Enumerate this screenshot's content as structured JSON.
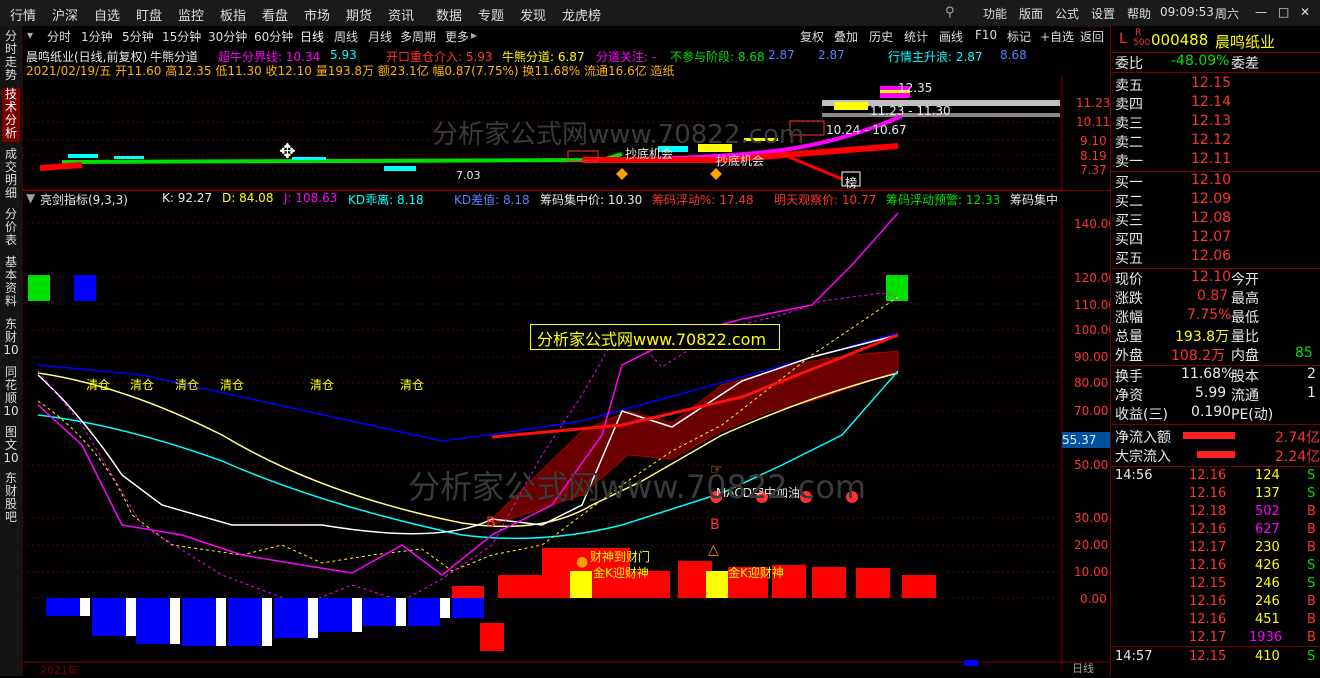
{
  "menu": {
    "items": [
      "行情",
      "沪深",
      "自选",
      "盯盘",
      "监控",
      "板指",
      "看盘",
      "市场",
      "期货",
      "资讯",
      "数据",
      "专题",
      "发现",
      "龙虎榜"
    ],
    "right": [
      "功能",
      "版面",
      "公式",
      "设置",
      "帮助"
    ],
    "time": "09:09:53",
    "weekday": "周六"
  },
  "left_tabs": [
    "分时走势",
    "技术分析",
    "成交明细",
    "分价表",
    "基本资料",
    "东财10",
    "同花顺10",
    "图文10",
    "东财股吧"
  ],
  "periods": [
    "分时",
    "1分钟",
    "5分钟",
    "15分钟",
    "30分钟",
    "60分钟",
    "日线",
    "周线",
    "月线",
    "多周期",
    "更多"
  ],
  "tools": [
    "复权",
    "叠加",
    "历史",
    "统计",
    "画线",
    "F10",
    "标记",
    "+自选",
    "返回"
  ],
  "main_header": {
    "name": "晨鸣纸业(日线,前复权)",
    "ind": "牛熊分道",
    "l1": "超牛分界线: 10.34",
    "l2": "5.93",
    "l3": "开口重仓介入: 5.93",
    "l4": "牛熊分道: 6.87",
    "l5": "分道关注: -",
    "l6": "不参与阶段: 8.68",
    "l7": "2.87",
    "l8": "2.87",
    "l9": "行情主升浪: 2.87",
    "l10": "8.68"
  },
  "ohlc": "2021/02/19/五 开11.60 高12.35 低11.30 收12.10 量193.8万 额23.1亿 幅0.87(7.75%) 换11.68% 流通16.6亿 造纸",
  "upper_axis": [
    "11.23",
    "10.11",
    "9.10",
    "8.19",
    "7.37"
  ],
  "upper_annot": {
    "hi": "12.35",
    "r1": "11.23 - 11.30",
    "r2": "10.24 - 10.67",
    "lo": "7.03",
    "buy1": "抄底机会",
    "buy2": "抄底机会",
    "tag": "榜"
  },
  "watermark1": "分析家公式网www.70822.com",
  "watermark2": "分析家公式网www.70822.com",
  "watermark3": "分析家公式网www.70822.com",
  "lower_header": {
    "name": "亮剑指标(9,3,3)",
    "k": "K: 92.27",
    "d": "D: 84.08",
    "j": "J: 108.63",
    "kdj": "KD乖离: 8.18",
    "kdm": "KD差值: 8.18",
    "c1": "筹码集中价: 10.30",
    "c2": "筹码浮动%: 17.48",
    "c3": "明天观察价: 10.77",
    "c4": "筹码浮动预警: 12.33",
    "c5": "筹码集中"
  },
  "lower_axis": [
    "140.00",
    "120.00",
    "110.00",
    "100.00",
    "90.00",
    "80.00",
    "70.00",
    "50.00",
    "30.00",
    "20.00",
    "10.00",
    "0.00"
  ],
  "cur_val": "55.37",
  "qingcang": [
    "清仓",
    "清仓",
    "清仓",
    "清仓",
    "清仓",
    "清仓"
  ],
  "lower_annot": {
    "b1": "B",
    "b2": "B",
    "a1": "财神到财门",
    "a2": "金K迎财神",
    "a3": "金K迎财神",
    "a4": "MACD空中加油"
  },
  "bottom": {
    "year": "2021年",
    "rt": "日线"
  },
  "stock": {
    "prefix": "L",
    "r": "R",
    "code_sub": "500",
    "code": "000488",
    "name": "晨鸣纸业",
    "weibi_label": "委比",
    "weibi": "-48.09%",
    "weicha_label": "委差",
    "asks": [
      {
        "l": "卖五",
        "p": "12.15"
      },
      {
        "l": "卖四",
        "p": "12.14"
      },
      {
        "l": "卖三",
        "p": "12.13"
      },
      {
        "l": "卖二",
        "p": "12.12"
      },
      {
        "l": "卖一",
        "p": "12.11"
      }
    ],
    "bids": [
      {
        "l": "买一",
        "p": "12.10"
      },
      {
        "l": "买二",
        "p": "12.09"
      },
      {
        "l": "买三",
        "p": "12.08"
      },
      {
        "l": "买四",
        "p": "12.07"
      },
      {
        "l": "买五",
        "p": "12.06"
      }
    ],
    "quote": [
      {
        "l": "现价",
        "v": "12.10",
        "l2": "今开"
      },
      {
        "l": "涨跌",
        "v": "0.87",
        "l2": "最高"
      },
      {
        "l": "涨幅",
        "v": "7.75%",
        "l2": "最低"
      },
      {
        "l": "总量",
        "v": "193.8万",
        "l2": "量比"
      },
      {
        "l": "外盘",
        "v": "108.2万",
        "l2": "内盘",
        "v2": "85"
      }
    ],
    "fin": [
      {
        "l": "换手",
        "v": "11.68%",
        "l2": "股本",
        "v2": "2"
      },
      {
        "l": "净资",
        "v": "5.99",
        "l2": "流通",
        "v2": "1"
      },
      {
        "l": "收益(三)",
        "v": "0.190",
        "l2": "PE(动)",
        "v2": ""
      }
    ],
    "flow": [
      {
        "l": "净流入额",
        "v": "2.74亿"
      },
      {
        "l": "大宗流入",
        "v": "2.24亿"
      }
    ],
    "ticks": [
      {
        "t": "14:56",
        "p": "12.16",
        "v": "124",
        "s": "S"
      },
      {
        "t": "",
        "p": "12.16",
        "v": "137",
        "s": "S"
      },
      {
        "t": "",
        "p": "12.18",
        "v": "502",
        "s": "B"
      },
      {
        "t": "",
        "p": "12.16",
        "v": "627",
        "s": "B"
      },
      {
        "t": "",
        "p": "12.17",
        "v": "230",
        "s": "B"
      },
      {
        "t": "",
        "p": "12.16",
        "v": "426",
        "s": "S"
      },
      {
        "t": "",
        "p": "12.15",
        "v": "246",
        "s": "S"
      },
      {
        "t": "",
        "p": "12.16",
        "v": "246",
        "s": "B"
      },
      {
        "t": "",
        "p": "12.16",
        "v": "451",
        "s": "B"
      },
      {
        "t": "",
        "p": "12.17",
        "v": "1936",
        "s": "B"
      },
      {
        "t": "14:57",
        "p": "12.15",
        "v": "410",
        "s": "S"
      }
    ]
  },
  "colors": {
    "bg": "#000000",
    "accent": "#7a0000",
    "up": "#ff3232",
    "down": "#00e000",
    "kline": "#ffff00"
  }
}
